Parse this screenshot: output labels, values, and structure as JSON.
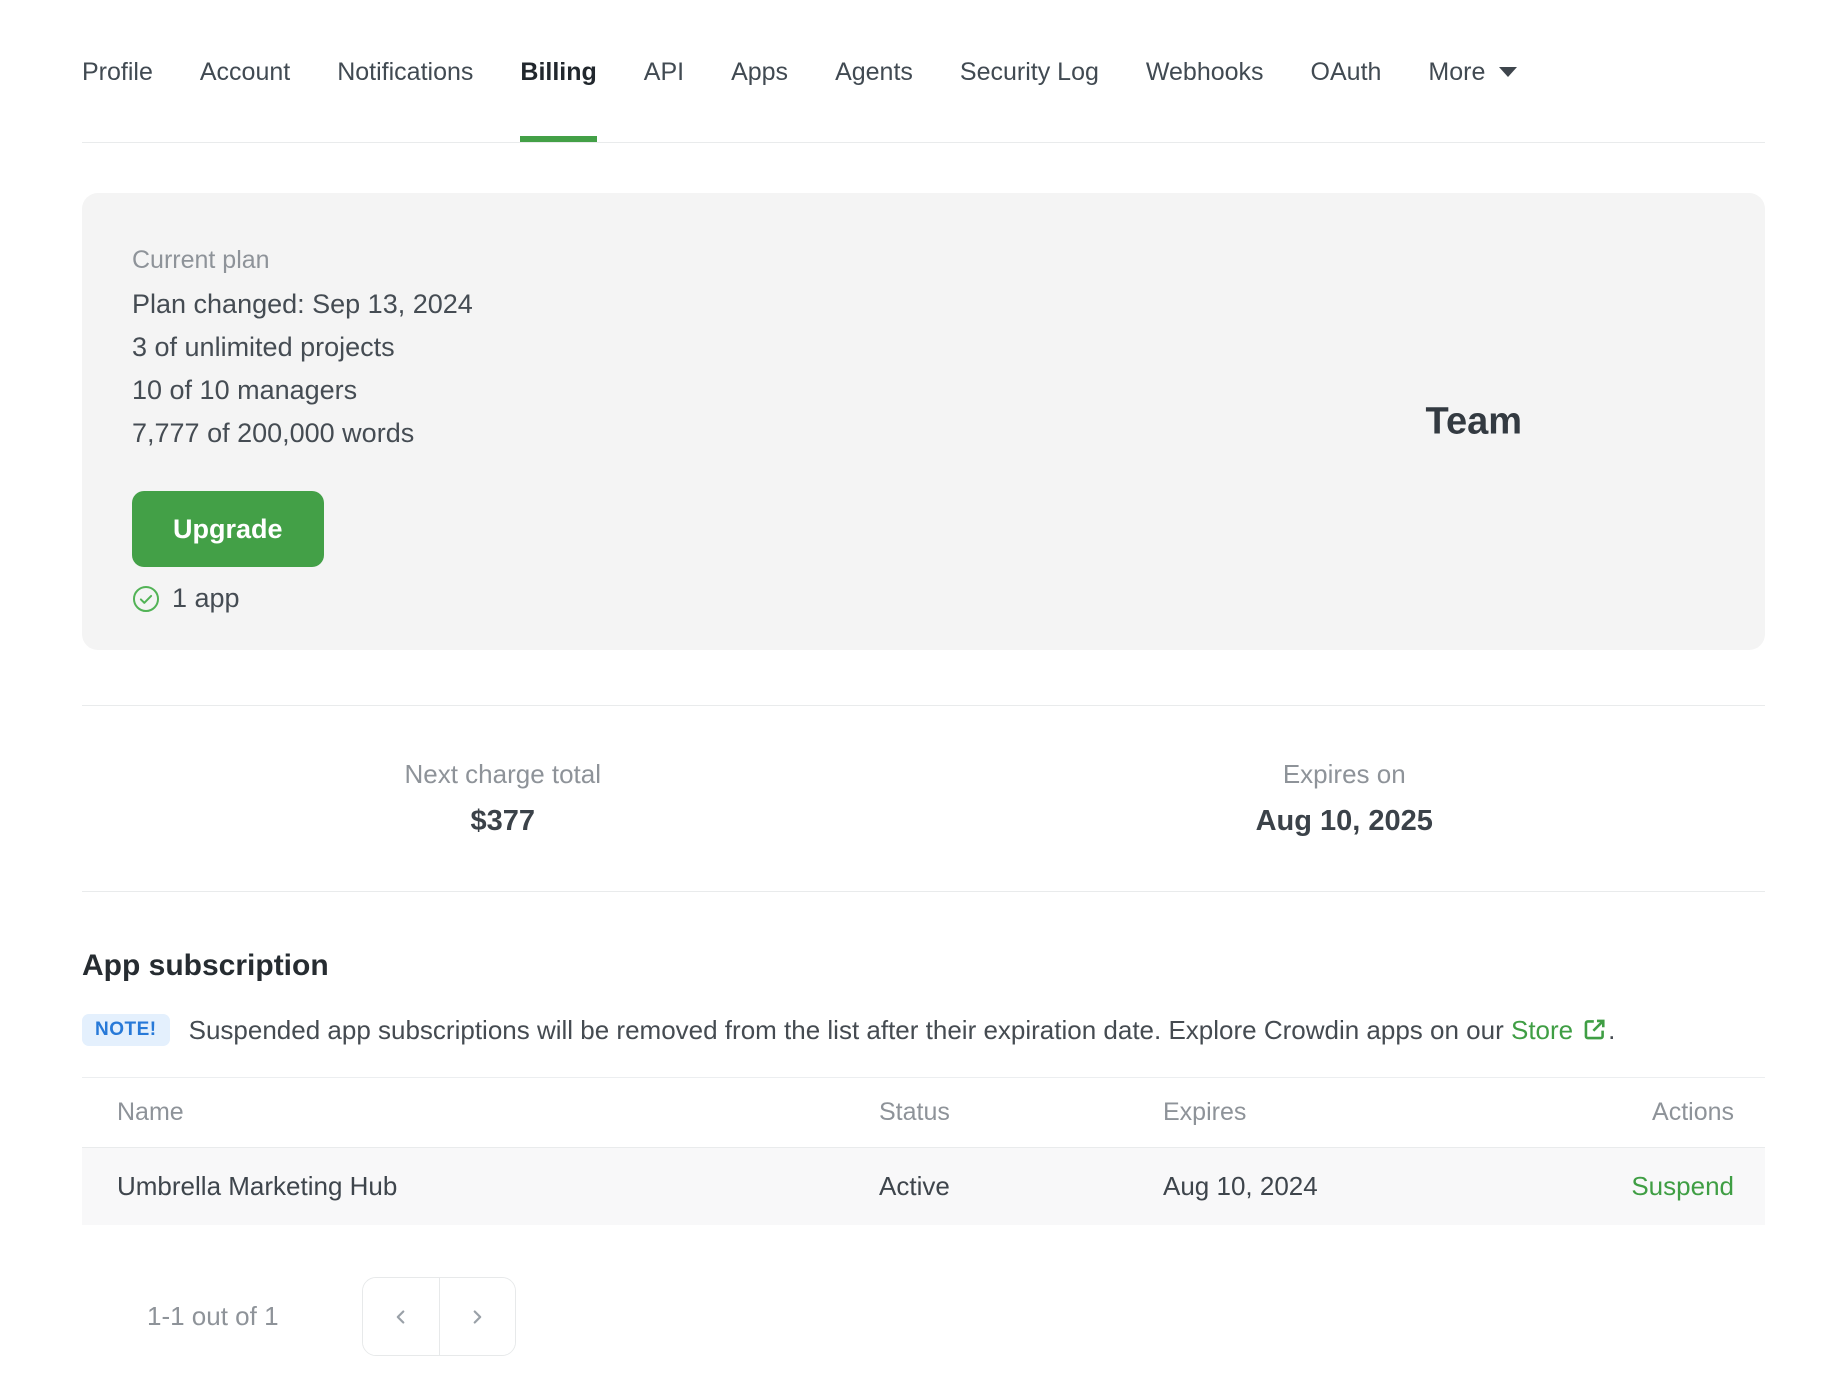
{
  "nav": {
    "tabs": [
      {
        "label": "Profile",
        "active": false
      },
      {
        "label": "Account",
        "active": false
      },
      {
        "label": "Notifications",
        "active": false
      },
      {
        "label": "Billing",
        "active": true
      },
      {
        "label": "API",
        "active": false
      },
      {
        "label": "Apps",
        "active": false
      },
      {
        "label": "Agents",
        "active": false
      },
      {
        "label": "Security Log",
        "active": false
      },
      {
        "label": "Webhooks",
        "active": false
      },
      {
        "label": "OAuth",
        "active": false
      },
      {
        "label": "More",
        "active": false,
        "has_dropdown": true
      }
    ]
  },
  "plan_card": {
    "label": "Current plan",
    "lines": [
      "Plan changed: Sep 13, 2024",
      "3 of unlimited projects",
      "10 of 10 managers",
      "7,777 of 200,000 words"
    ],
    "upgrade_label": "Upgrade",
    "apps_note": "1 app",
    "plan_name": "Team"
  },
  "billing_summary": {
    "next_charge_label": "Next charge total",
    "next_charge_value": "$377",
    "expires_label": "Expires on",
    "expires_value": "Aug 10, 2025"
  },
  "app_subscription": {
    "title": "App subscription",
    "note_badge": "NOTE!",
    "note_text_before_link": "Suspended app subscriptions will be removed from the list after their expiration date. Explore Crowdin apps on our ",
    "note_link": "Store",
    "note_suffix": ".",
    "table": {
      "headers": [
        "Name",
        "Status",
        "Expires",
        "Actions"
      ],
      "rows": [
        {
          "name": "Umbrella Marketing Hub",
          "status": "Active",
          "expires": "Aug 10, 2024",
          "action": "Suspend"
        }
      ]
    },
    "pagination": {
      "label": "1-1 out of 1"
    }
  },
  "colors": {
    "accent_green": "#43a047",
    "link_green": "#3f9e44",
    "note_badge_text": "#2779d8",
    "note_badge_bg": "#e4f0fd",
    "card_bg": "#f4f4f4",
    "muted_text": "#8e9399",
    "dark_text": "#3e454c"
  }
}
